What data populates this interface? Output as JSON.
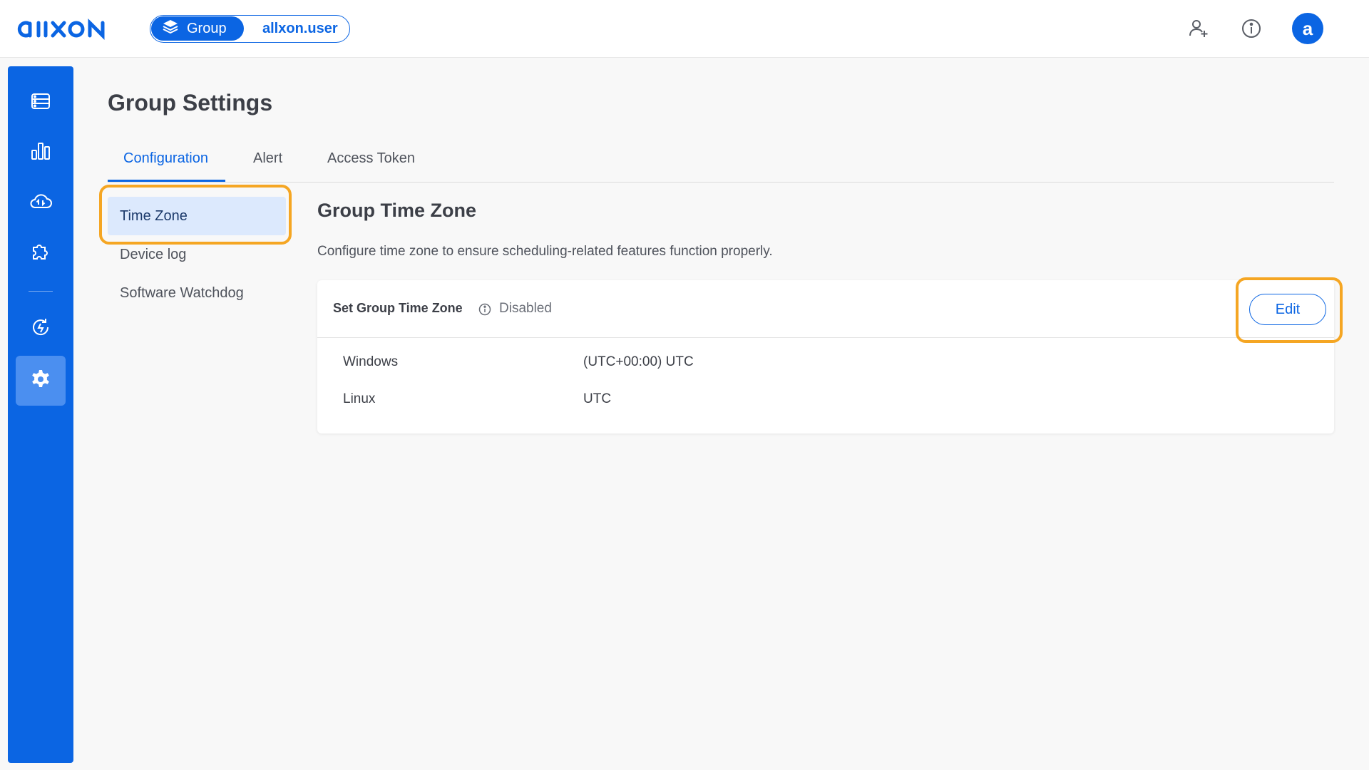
{
  "app": {
    "logo_text": "aııxon",
    "brand_color": "#0b65e3",
    "highlight_color": "#f5a623"
  },
  "header": {
    "context_group_label": "Group",
    "context_user": "allxon.user",
    "icons": [
      "add-user-icon",
      "info-icon"
    ],
    "avatar_letter": "a"
  },
  "sidebar": {
    "items": [
      {
        "icon": "devices-icon",
        "active": false
      },
      {
        "icon": "analytics-icon",
        "active": false
      },
      {
        "icon": "cloud-sync-icon",
        "active": false
      },
      {
        "icon": "plugin-icon",
        "active": false
      },
      {
        "icon": "ota-update-icon",
        "active": false
      },
      {
        "icon": "settings-icon",
        "active": true
      }
    ]
  },
  "page": {
    "title": "Group Settings",
    "tabs": [
      {
        "label": "Configuration",
        "active": true
      },
      {
        "label": "Alert",
        "active": false
      },
      {
        "label": "Access Token",
        "active": false
      }
    ],
    "subnav": [
      {
        "label": "Time Zone",
        "active": true
      },
      {
        "label": "Device log",
        "active": false
      },
      {
        "label": "Software Watchdog",
        "active": false
      }
    ]
  },
  "section": {
    "title": "Group Time Zone",
    "description": "Configure time zone to ensure scheduling-related features function properly.",
    "card": {
      "title": "Set Group Time Zone",
      "status": "Disabled",
      "edit_label": "Edit",
      "rows": [
        {
          "label": "Windows",
          "value": "(UTC+00:00) UTC"
        },
        {
          "label": "Linux",
          "value": "UTC"
        }
      ]
    }
  }
}
